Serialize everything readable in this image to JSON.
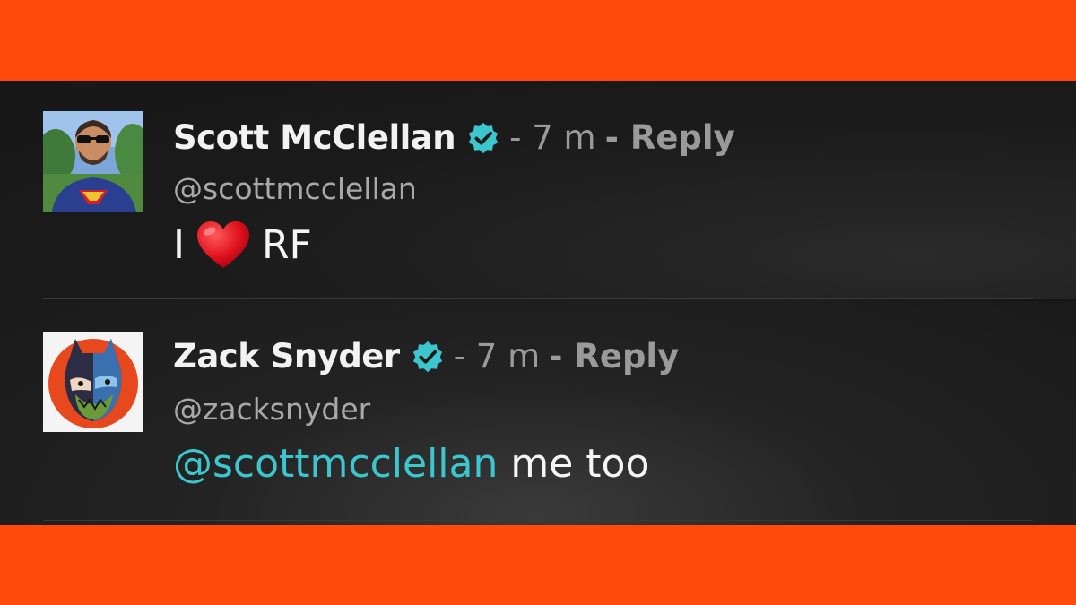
{
  "colors": {
    "frame": "#ff4a0c",
    "panel": "#1c1c1c",
    "verified": "#3cc7cf",
    "mention": "#3cc7cf",
    "meta": "#9a9a9a",
    "text": "#f5f5f5"
  },
  "comments": [
    {
      "avatar_icon": "user-avatar-photo",
      "name": "Scott McClellan",
      "verified_icon": "verified-badge-icon",
      "time": "- 7 m",
      "reply_label": "- Reply",
      "handle": "@scottmcclellan",
      "text_before": "I",
      "emoji": "heart-emoji",
      "text_after": "RF"
    },
    {
      "avatar_icon": "user-avatar-illustration",
      "name": "Zack Snyder",
      "verified_icon": "verified-badge-icon",
      "time": "- 7 m",
      "reply_label": "- Reply",
      "handle": "@zacksnyder",
      "mention": "@scottmcclellan",
      "text_after": " me too"
    }
  ]
}
